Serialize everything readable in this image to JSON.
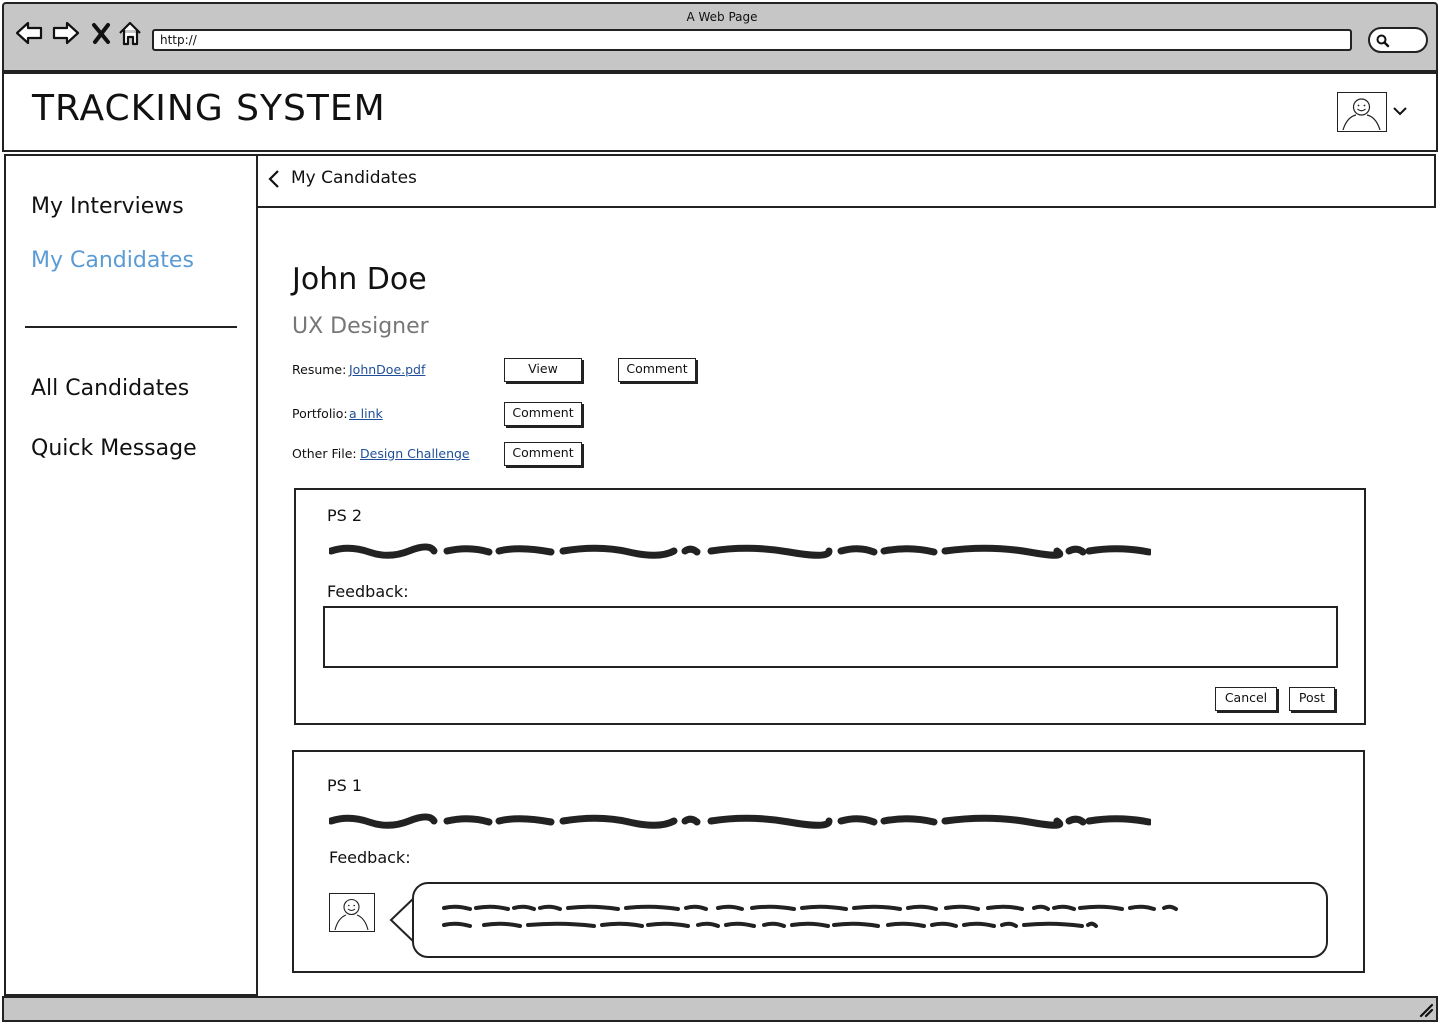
{
  "browser": {
    "window_title": "A Web Page",
    "url": "http://"
  },
  "header": {
    "app_title": "TRACKING SYSTEM"
  },
  "sidebar": {
    "items": [
      {
        "label": "My Interviews"
      },
      {
        "label": "My Candidates"
      },
      {
        "label": "All Candidates"
      },
      {
        "label": "Quick Message"
      }
    ],
    "active": "My Candidates"
  },
  "breadcrumb": {
    "label": "My Candidates"
  },
  "candidate": {
    "name": "John Doe",
    "role": "UX Designer"
  },
  "files": {
    "resume": {
      "label": "Resume:",
      "link": "JohnDoe.pdf",
      "view_btn": "View",
      "comment_btn": "Comment"
    },
    "portfolio": {
      "label": "Portfolio:",
      "link": "a link",
      "comment_btn": "Comment"
    },
    "other": {
      "label": "Other File:",
      "link": "Design Challenge",
      "comment_btn": "Comment"
    }
  },
  "ps2": {
    "title": "PS 2",
    "feedback_label": "Feedback:",
    "feedback_value": "",
    "cancel_btn": "Cancel",
    "post_btn": "Post"
  },
  "ps1": {
    "title": "PS 1",
    "feedback_label": "Feedback:"
  },
  "colors": {
    "accent": "#5b9bd5",
    "link": "#1f4e99",
    "chrome": "#c6c6c6"
  },
  "icons": {
    "back": "back-arrow-icon",
    "forward": "forward-arrow-icon",
    "stop": "close-icon",
    "home": "home-icon",
    "search": "search-icon",
    "user": "user-avatar-icon",
    "dropdown": "chevron-down-icon",
    "crumb": "chevron-left-icon",
    "resize": "resize-grip-icon"
  }
}
